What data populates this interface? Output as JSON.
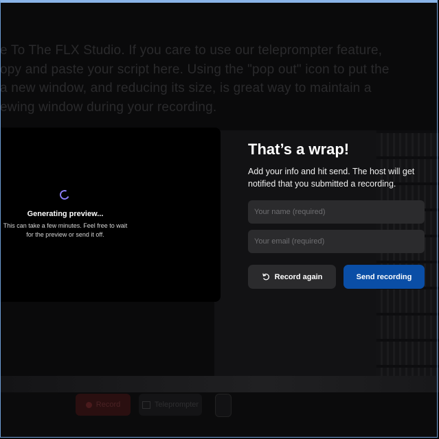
{
  "background": {
    "script_lines": [
      "e To The FLX Studio. If you care to use our teleprompter feature,",
      "opy and paste your script here. Using the \"pop out\" icon to put the",
      "a new window, and reducing its size, is great way to maintain a",
      "ewing window during your recording."
    ],
    "record_label": "Record",
    "teleprompter_label": "Teleprompter"
  },
  "preview": {
    "title": "Generating preview...",
    "subtitle": "This can take a few minutes. Feel free to wait for the preview or send it off."
  },
  "form": {
    "title": "That’s a wrap!",
    "description": "Add your info and hit send. The host will get notified that you submitted a recording.",
    "name_placeholder": "Your name (required)",
    "email_placeholder": "Your email (required)",
    "record_again_label": "Record again",
    "send_label": "Send recording"
  },
  "colors": {
    "accent": "#0a4ea6",
    "spinner": "#8b7cf6",
    "field_bg": "#2b2b2d"
  },
  "icons": {
    "spinner": "loading-spinner-icon",
    "record_again": "rotate-ccw-icon",
    "record_dot": "record-dot-icon",
    "teleprompter": "teleprompter-icon",
    "pop_out": "pop-out-icon"
  }
}
